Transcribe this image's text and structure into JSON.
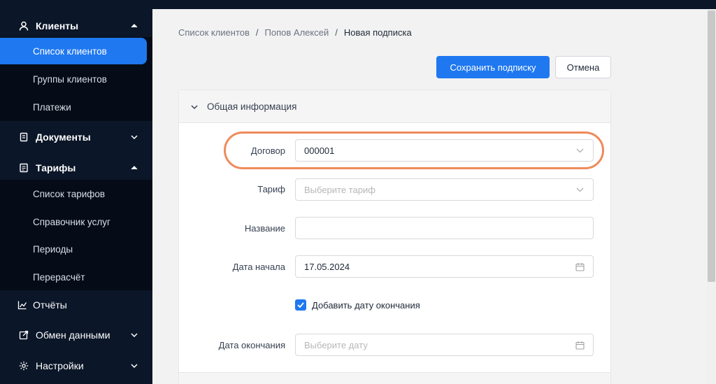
{
  "sidebar": {
    "groups": [
      {
        "label": "Клиенты",
        "icon": "user-icon",
        "expanded": true
      },
      {
        "label": "Документы",
        "icon": "document-icon",
        "expanded": false
      },
      {
        "label": "Тарифы",
        "icon": "tariff-icon",
        "expanded": true
      },
      {
        "label": "Отчёты",
        "icon": "chart-icon"
      },
      {
        "label": "Обмен данными",
        "icon": "exchange-icon",
        "expanded": false
      },
      {
        "label": "Настройки",
        "icon": "gear-icon",
        "expanded": false
      }
    ],
    "clients_items": [
      {
        "label": "Список клиентов",
        "active": true
      },
      {
        "label": "Группы клиентов"
      },
      {
        "label": "Платежи"
      }
    ],
    "tariff_items": [
      {
        "label": "Список тарифов"
      },
      {
        "label": "Справочник услуг"
      },
      {
        "label": "Периоды"
      },
      {
        "label": "Перерасчёт"
      }
    ]
  },
  "breadcrumb": {
    "items": [
      "Список клиентов",
      "Попов Алексей"
    ],
    "separator": "/",
    "current": "Новая подписка"
  },
  "actions": {
    "save_label": "Сохранить подписку",
    "cancel_label": "Отмена"
  },
  "form": {
    "section_title": "Общая информация",
    "contract": {
      "label": "Договор",
      "value": "000001"
    },
    "tariff": {
      "label": "Тариф",
      "placeholder": "Выберите тариф"
    },
    "name": {
      "label": "Название",
      "value": ""
    },
    "start_date": {
      "label": "Дата начала",
      "value": "17.05.2024"
    },
    "add_end_date": {
      "label": "Добавить дату окончания",
      "checked": true
    },
    "end_date": {
      "label": "Дата окончания",
      "placeholder": "Выберите дату"
    }
  },
  "colors": {
    "sidebar_bg": "#0b1628",
    "accent": "#1f78f0",
    "highlight": "#ef8a5b"
  }
}
